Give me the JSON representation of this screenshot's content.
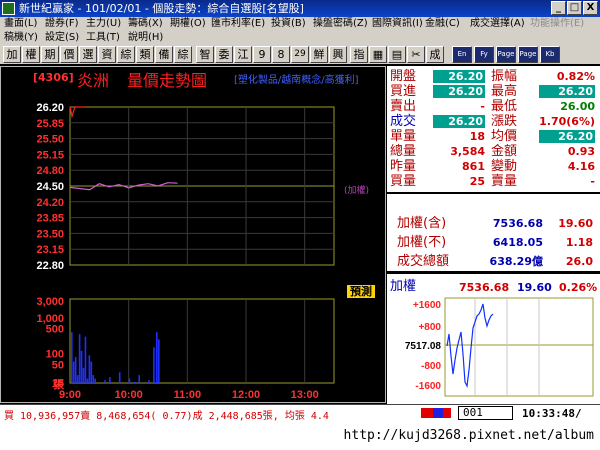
{
  "window": {
    "title": "新世紀贏家 - 101/02/01 - 個股走勢：綜合自選股[名望股]",
    "controls": [
      "_",
      "□",
      "X"
    ]
  },
  "menu1": [
    "畫面(L)",
    "證券(F)",
    "主力(U)",
    "籌碼(X)",
    "期權(O)",
    "匯市利率(E)",
    "投資(B)",
    "操盤密碼(Z)",
    "國際資訊(I)",
    "金融(C)",
    "成交選擇(A)",
    "功能操作(E)"
  ],
  "menu2": [
    "稿機(Y)",
    "設定(S)",
    "工具(T)",
    "說明(H)"
  ],
  "toolbar": [
    "加",
    "權",
    "期",
    "價",
    "選",
    "資",
    "綜",
    "類",
    "備",
    "綜",
    "智",
    "委",
    "江",
    "9",
    "8",
    "29",
    "鮮",
    "興",
    "指",
    "▦",
    "▤",
    "✂",
    "成",
    "En",
    "Fy",
    "Page",
    "Page",
    "Kb"
  ],
  "chart": {
    "stock_code": "[4306]",
    "stock_name": "炎洲",
    "title": "量價走勢圖",
    "categories": "[塑化製品/越南概念/高獲利]",
    "price_ticks": [
      "26.20",
      "25.85",
      "25.50",
      "25.15",
      "24.80",
      "24.50",
      "24.20",
      "23.85",
      "23.50",
      "23.15",
      "22.80"
    ],
    "volume_ticks": [
      "3,000",
      "1,000",
      "500",
      "100",
      "50",
      "15"
    ],
    "volume_unit": "張",
    "time_ticks": [
      "9:00",
      "10:00",
      "11:00",
      "12:00",
      "13:00"
    ],
    "ref_label": "(加權)",
    "tag": "預測"
  },
  "chart_data": {
    "type": "line",
    "title": "量價走勢圖",
    "xlabel": "",
    "ylabel": "",
    "x_range": [
      "9:00",
      "13:30"
    ],
    "ylim": [
      22.8,
      26.2
    ],
    "series": [
      {
        "name": "",
        "times": [
          "9:00",
          "9:02",
          "9:05",
          "9:15"
        ],
        "values": [
          26.2,
          26.0,
          26.2,
          26.2
        ]
      },
      {
        "name": "加權",
        "times": [
          "9:00",
          "9:20",
          "9:30",
          "9:40",
          "9:50",
          "10:00",
          "10:10",
          "10:20",
          "10:30",
          "10:40",
          "10:50"
        ],
        "values": [
          24.47,
          24.42,
          24.55,
          24.48,
          24.53,
          24.46,
          24.52,
          24.55,
          24.5,
          24.57,
          24.56
        ]
      }
    ],
    "volume": {
      "type": "bar",
      "unit": "張",
      "scale": "log",
      "times": [
        "9:01",
        "9:03",
        "9:05",
        "9:07",
        "9:09",
        "9:11",
        "9:13",
        "9:15",
        "9:17",
        "9:19",
        "9:21",
        "9:23",
        "9:25",
        "9:30",
        "9:35",
        "9:40",
        "9:45",
        "9:50",
        "9:55",
        "10:00",
        "10:05",
        "10:10",
        "10:15",
        "10:20",
        "10:25",
        "10:28",
        "10:30"
      ],
      "values": [
        400,
        60,
        80,
        25,
        350,
        120,
        40,
        300,
        20,
        90,
        60,
        25,
        20,
        15,
        18,
        22,
        15,
        30,
        15,
        20,
        16,
        25,
        15,
        18,
        150,
        400,
        250
      ]
    }
  },
  "quote": {
    "rows": [
      {
        "l1": "開盤",
        "v1": "26.20",
        "l2": "振幅",
        "v2": "0.82%"
      },
      {
        "l1": "買進",
        "v1": "26.20",
        "l2": "最高",
        "v2": "26.20"
      },
      {
        "l1": "賣出",
        "v1": "-",
        "l2": "最低",
        "v2": "26.00"
      },
      {
        "l1": "成交",
        "v1": "26.20",
        "l2": "漲跌",
        "v2": "1.70(6%)"
      },
      {
        "l1": "單量",
        "v1": "18",
        "l2": "均價",
        "v2": "26.20"
      },
      {
        "l1": "總量",
        "v1": "3,584",
        "l2": "金額",
        "v2": "0.93"
      },
      {
        "l1": "昨量",
        "v1": "861",
        "l2": "變動",
        "v2": "4.16"
      },
      {
        "l1": "買量",
        "v1": "25",
        "l2": "賣量",
        "v2": "-"
      }
    ]
  },
  "index": {
    "rows": [
      {
        "label": "加權(含)",
        "v1": "7536.68",
        "v2": "19.60"
      },
      {
        "label": "加權(不)",
        "v1": "6418.05",
        "v2": "1.18"
      },
      {
        "label": "成交總額",
        "v1": "638.29億",
        "v2": "26.0"
      }
    ]
  },
  "mini": {
    "label": "加權",
    "value": "7536.68",
    "change": "19.60",
    "pct": "0.26%",
    "ticks": [
      "+1600",
      "+800",
      "7517.08",
      "-800",
      "-1600"
    ]
  },
  "status": {
    "text": "買 10,936,957賣 8,468,654( 0.77)成 2,448,685張, 均張 4.4",
    "input": "001",
    "clock": "10:33:48/"
  },
  "watermark": "http://kujd3268.pixnet.net/album"
}
